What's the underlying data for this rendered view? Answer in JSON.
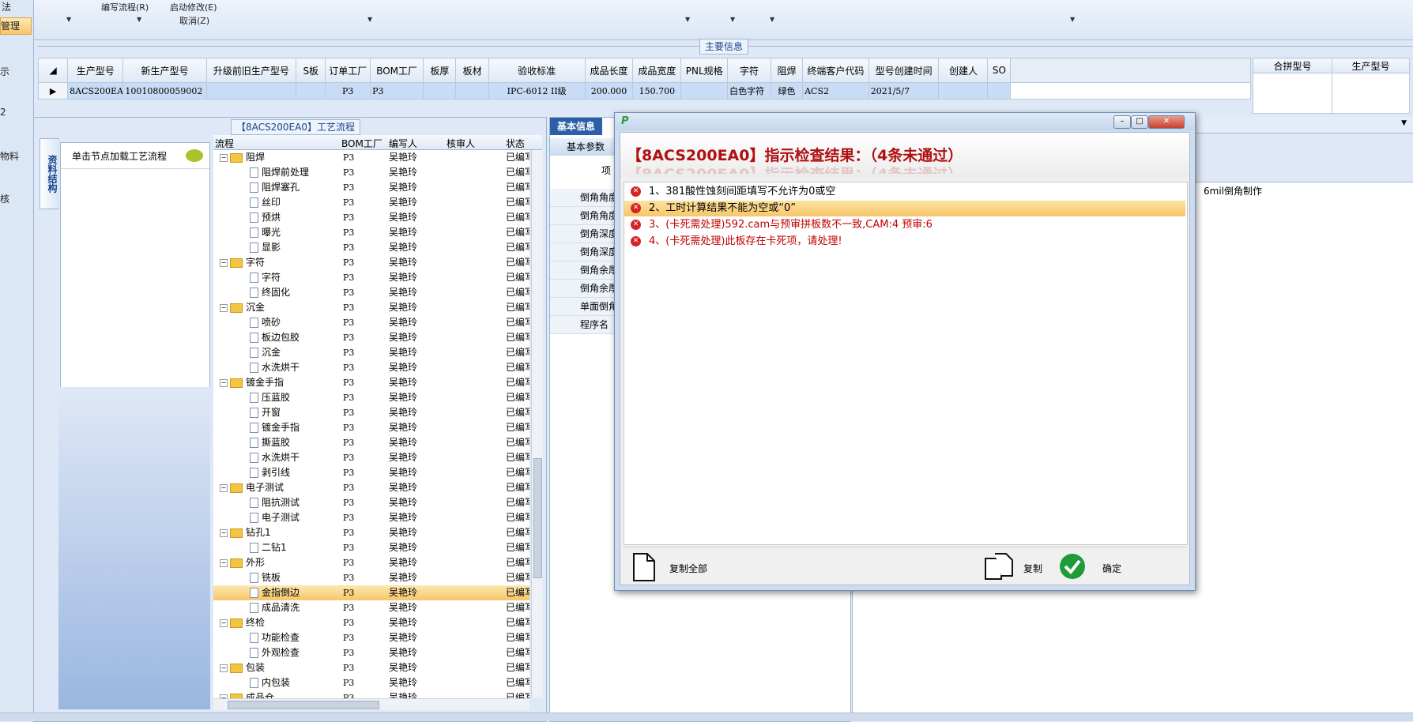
{
  "ribbon": {
    "items": [
      {
        "label": "编写流程(R)"
      },
      {
        "label": "启动修改(E)"
      },
      {
        "label": "取消(Z)"
      }
    ],
    "left_top": "法"
  },
  "leftnav": {
    "items": [
      "管理",
      "示",
      "2",
      "物料",
      "核"
    ]
  },
  "main_info": {
    "caption": "主要信息",
    "columns": [
      "生产型号",
      "新生产型号",
      "升级前旧生产型号",
      "S板",
      "订单工厂",
      "BOM工厂",
      "板厚",
      "板材",
      "验收标准",
      "成品长度",
      "成品宽度",
      "PNL规格",
      "字符",
      "阻焊",
      "终端客户代码",
      "型号创建时间",
      "创建人",
      "SO"
    ],
    "row": [
      "8ACS200EA0",
      "10010800059002",
      "",
      "",
      "P3",
      "P3",
      "",
      "",
      "IPC-6012 II级",
      "200.000",
      "150.700",
      "",
      "白色字符",
      "绿色",
      "ACS2",
      "2021/5/7",
      "",
      ""
    ],
    "right_columns": [
      "合拼型号",
      "生产型号"
    ]
  },
  "process": {
    "caption": "【8ACS200EA0】工艺流程",
    "vtab_label": "资料结构",
    "load_label": "单击节点加载工艺流程",
    "headers": [
      "流程",
      "BOM工厂",
      "编写人",
      "核审人",
      "状态"
    ],
    "rows": [
      {
        "name": "阻焊",
        "level": 0,
        "factory": "P3",
        "writer": "吴艳玲",
        "status": "已编写"
      },
      {
        "name": "阻焊前处理",
        "level": 1,
        "factory": "P3",
        "writer": "吴艳玲",
        "status": "已编写"
      },
      {
        "name": "阻焊塞孔",
        "level": 1,
        "factory": "P3",
        "writer": "吴艳玲",
        "status": "已编写"
      },
      {
        "name": "丝印",
        "level": 1,
        "factory": "P3",
        "writer": "吴艳玲",
        "status": "已编写"
      },
      {
        "name": "预烘",
        "level": 1,
        "factory": "P3",
        "writer": "吴艳玲",
        "status": "已编写"
      },
      {
        "name": "曝光",
        "level": 1,
        "factory": "P3",
        "writer": "吴艳玲",
        "status": "已编写"
      },
      {
        "name": "显影",
        "level": 1,
        "factory": "P3",
        "writer": "吴艳玲",
        "status": "已编写"
      },
      {
        "name": "字符",
        "level": 0,
        "factory": "P3",
        "writer": "吴艳玲",
        "status": "已编写"
      },
      {
        "name": "字符",
        "level": 1,
        "factory": "P3",
        "writer": "吴艳玲",
        "status": "已编写"
      },
      {
        "name": "终固化",
        "level": 1,
        "factory": "P3",
        "writer": "吴艳玲",
        "status": "已编写"
      },
      {
        "name": "沉金",
        "level": 0,
        "factory": "P3",
        "writer": "吴艳玲",
        "status": "已编写"
      },
      {
        "name": "喷砂",
        "level": 1,
        "factory": "P3",
        "writer": "吴艳玲",
        "status": "已编写"
      },
      {
        "name": "板边包胶",
        "level": 1,
        "factory": "P3",
        "writer": "吴艳玲",
        "status": "已编写"
      },
      {
        "name": "沉金",
        "level": 1,
        "factory": "P3",
        "writer": "吴艳玲",
        "status": "已编写"
      },
      {
        "name": "水洗烘干",
        "level": 1,
        "factory": "P3",
        "writer": "吴艳玲",
        "status": "已编写"
      },
      {
        "name": "镀金手指",
        "level": 0,
        "factory": "P3",
        "writer": "吴艳玲",
        "status": "已编写"
      },
      {
        "name": "压蓝胶",
        "level": 1,
        "factory": "P3",
        "writer": "吴艳玲",
        "status": "已编写"
      },
      {
        "name": "开窗",
        "level": 1,
        "factory": "P3",
        "writer": "吴艳玲",
        "status": "已编写"
      },
      {
        "name": "镀金手指",
        "level": 1,
        "factory": "P3",
        "writer": "吴艳玲",
        "status": "已编写"
      },
      {
        "name": "撕蓝胶",
        "level": 1,
        "factory": "P3",
        "writer": "吴艳玲",
        "status": "已编写"
      },
      {
        "name": "水洗烘干",
        "level": 1,
        "factory": "P3",
        "writer": "吴艳玲",
        "status": "已编写"
      },
      {
        "name": "剥引线",
        "level": 1,
        "factory": "P3",
        "writer": "吴艳玲",
        "status": "已编写"
      },
      {
        "name": "电子测试",
        "level": 0,
        "factory": "P3",
        "writer": "吴艳玲",
        "status": "已编写"
      },
      {
        "name": "阻抗测试",
        "level": 1,
        "factory": "P3",
        "writer": "吴艳玲",
        "status": "已编写"
      },
      {
        "name": "电子测试",
        "level": 1,
        "factory": "P3",
        "writer": "吴艳玲",
        "status": "已编写"
      },
      {
        "name": "钻孔1",
        "level": 0,
        "factory": "P3",
        "writer": "吴艳玲",
        "status": "已编写"
      },
      {
        "name": "二钻1",
        "level": 1,
        "factory": "P3",
        "writer": "吴艳玲",
        "status": "已编写"
      },
      {
        "name": "外形",
        "level": 0,
        "factory": "P3",
        "writer": "吴艳玲",
        "status": "已编写"
      },
      {
        "name": "铣板",
        "level": 1,
        "factory": "P3",
        "writer": "吴艳玲",
        "status": "已编写"
      },
      {
        "name": "金指倒边",
        "level": 1,
        "factory": "P3",
        "writer": "吴艳玲",
        "status": "已编写",
        "selected": true
      },
      {
        "name": "成品清洗",
        "level": 1,
        "factory": "P3",
        "writer": "吴艳玲",
        "status": "已编写"
      },
      {
        "name": "终检",
        "level": 0,
        "factory": "P3",
        "writer": "吴艳玲",
        "status": "已编写"
      },
      {
        "name": "功能检查",
        "level": 1,
        "factory": "P3",
        "writer": "吴艳玲",
        "status": "已编写"
      },
      {
        "name": "外观检查",
        "level": 1,
        "factory": "P3",
        "writer": "吴艳玲",
        "status": "已编写"
      },
      {
        "name": "包装",
        "level": 0,
        "factory": "P3",
        "writer": "吴艳玲",
        "status": "已编写"
      },
      {
        "name": "内包装",
        "level": 1,
        "factory": "P3",
        "writer": "吴艳玲",
        "status": "已编写"
      },
      {
        "name": "成品仓",
        "level": 0,
        "factory": "P3",
        "writer": "吴艳玲",
        "status": "已编写"
      }
    ]
  },
  "basic": {
    "tab": "基本信息",
    "subtab": "基本参数",
    "col_header": "项",
    "items": [
      "倒角角度",
      "倒角角度",
      "倒角深度",
      "倒角深度",
      "倒角余厚",
      "倒角余厚",
      "单面倒角",
      "程序名"
    ]
  },
  "right": {
    "note": "6mil倒角制作"
  },
  "dialog": {
    "title_icon": "P",
    "heading": "【8ACS200EA0】指示检查结果：（4条未通过）",
    "messages": [
      {
        "text": "1、381酸性蚀刻间距填写不允许为0或空",
        "color": "#000000"
      },
      {
        "text": "2、工时计算结果不能为空或“0”",
        "color": "#000000",
        "selected": true
      },
      {
        "text": "3、(卡死需处理)592.cam与预审拼板数不一致,CAM:4 预审:6",
        "color": "#c00000"
      },
      {
        "text": "4、(卡死需处理)此板存在卡死项，请处理!",
        "color": "#c00000"
      }
    ],
    "copy_all": "复制全部",
    "copy": "复制",
    "ok": "确定"
  },
  "colors": {
    "accent": "#f7c66a",
    "error": "#d62424",
    "ok_green": "#1f9b3a",
    "heading_red": "#b01010"
  }
}
